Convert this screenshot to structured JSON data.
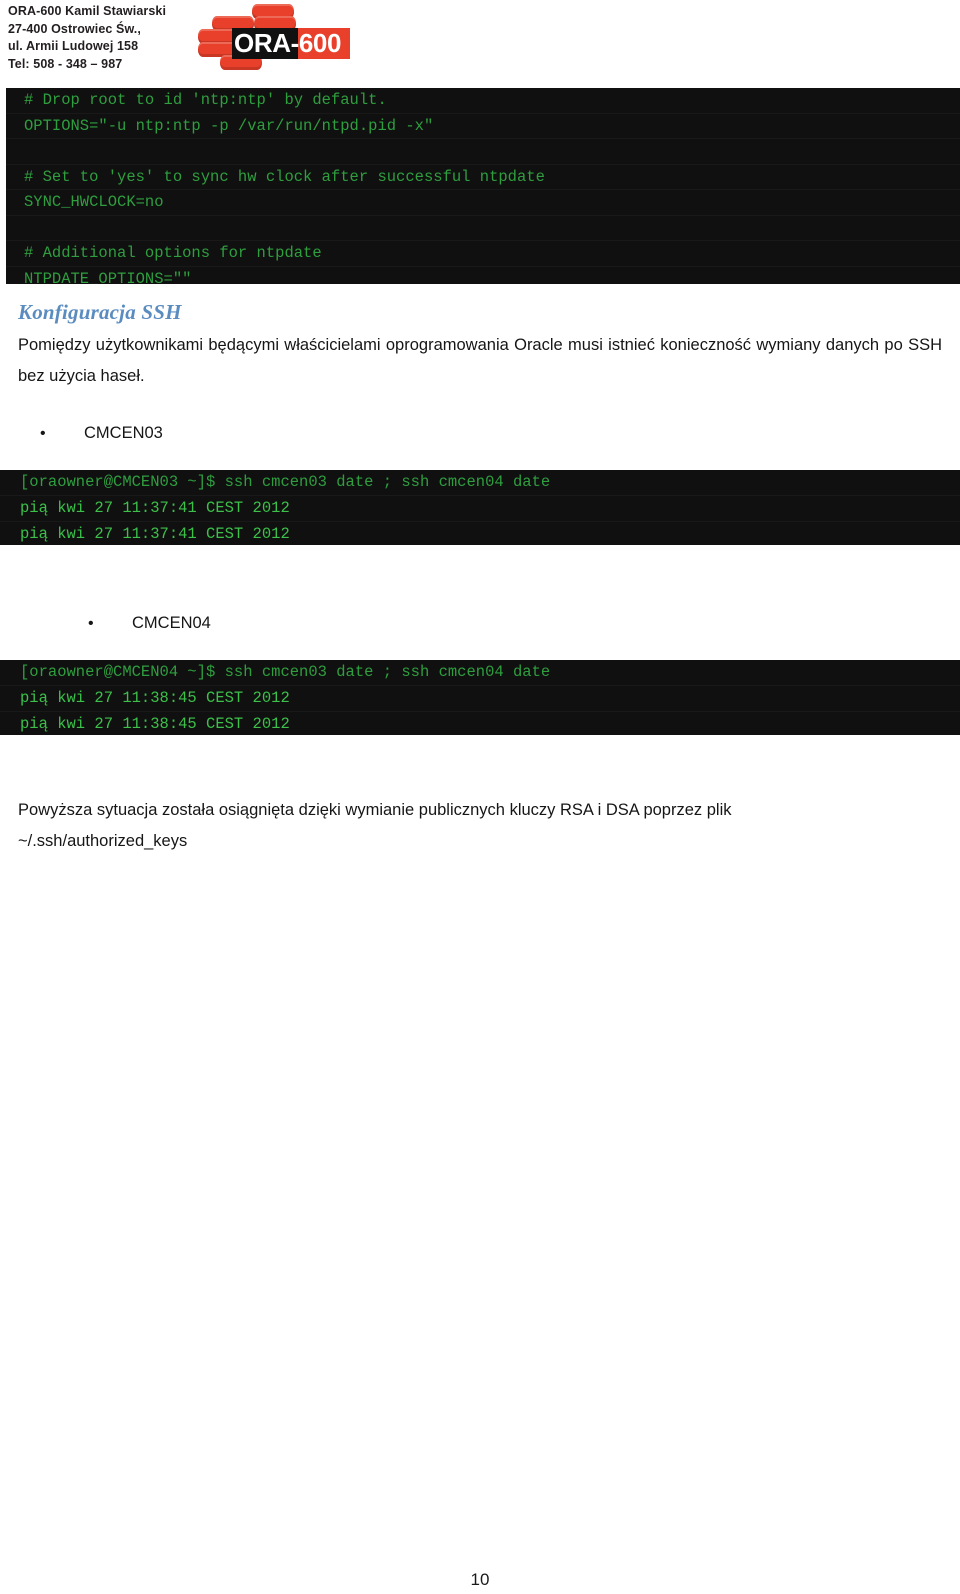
{
  "header": {
    "contact_lines": [
      "ORA-600 Kamil Stawiarski",
      "27-400 Ostrowiec Św.,",
      "ul. Armii Ludowej 158",
      "Tel: 508 - 348 – 987"
    ],
    "logo": {
      "wordmark": "ORA-600",
      "brand_red": "#e8402a",
      "banner_black": "#111111",
      "icon_name": "stacked-database-bricks"
    }
  },
  "terminals": {
    "ntp_config": {
      "lines": [
        {
          "text": "# Drop root to id 'ntp:ntp' by default.",
          "kind": "cmd"
        },
        {
          "text": "OPTIONS=\"-u ntp:ntp -p /var/run/ntpd.pid -x\"",
          "kind": "cmd"
        },
        {
          "text": "",
          "kind": "blank"
        },
        {
          "text": "# Set to 'yes' to sync hw clock after successful ntpdate",
          "kind": "cmd"
        },
        {
          "text": "SYNC_HWCLOCK=no",
          "kind": "cmd"
        },
        {
          "text": "",
          "kind": "blank"
        },
        {
          "text": "# Additional options for ntpdate",
          "kind": "cmd"
        },
        {
          "text": "NTPDATE_OPTIONS=\"\"",
          "kind": "cmd"
        }
      ]
    },
    "cmcen03": {
      "lines": [
        {
          "text": "[oraowner@CMCEN03 ~]$ ssh cmcen03 date ; ssh cmcen04 date",
          "kind": "cmd"
        },
        {
          "text": "pią kwi 27 11:37:41 CEST 2012",
          "kind": "out"
        },
        {
          "text": "pią kwi 27 11:37:41 CEST 2012",
          "kind": "out"
        }
      ]
    },
    "cmcen04": {
      "lines": [
        {
          "text": "[oraowner@CMCEN04 ~]$ ssh cmcen03 date ; ssh cmcen04 date",
          "kind": "cmd"
        },
        {
          "text": "pią kwi 27 11:38:45 CEST 2012",
          "kind": "out"
        },
        {
          "text": "pią kwi 27 11:38:45 CEST 2012",
          "kind": "out"
        }
      ]
    }
  },
  "content": {
    "heading_ssh": "Konfiguracja SSH",
    "heading_color": "#5b8cc0",
    "paragraph_intro": "Pomiędzy użytkownikami będącymi właścicielami oprogramowania Oracle musi istnieć konieczność wymiany danych po SSH bez użycia haseł.",
    "bullets": [
      {
        "marker": "•",
        "label": "CMCEN03"
      },
      {
        "marker": "•",
        "label": "CMCEN04"
      }
    ],
    "paragraph_closing": "Powyższa sytuacja została osiągnięta dzięki wymianie publicznych kluczy RSA i DSA poprzez plik",
    "paragraph_closing_path": "~/.ssh/authorized_keys"
  },
  "footer": {
    "page_number": "10"
  }
}
